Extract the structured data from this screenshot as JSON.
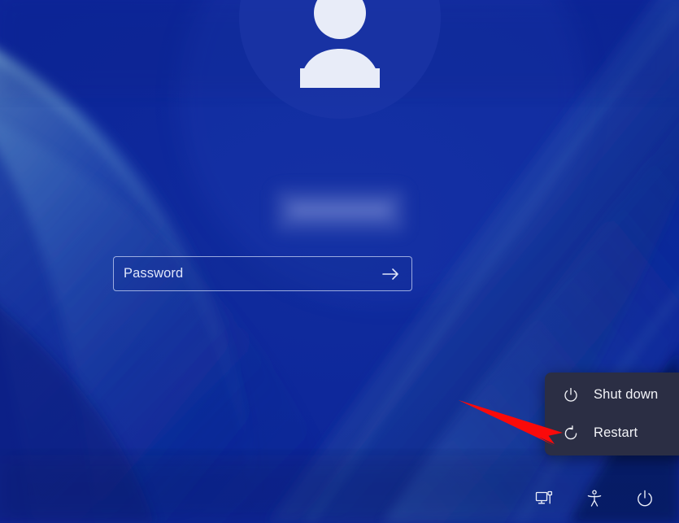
{
  "screen": {
    "kind": "windows-lock-screen",
    "background_name": "windows-bloom-wallpaper",
    "background_colors": {
      "deep": "#071659",
      "mid": "#0d2a9a",
      "bright": "#2f5ec0",
      "highlight": "#7fb4c9"
    }
  },
  "account": {
    "avatar_icon": "person-avatar-icon",
    "username": "",
    "username_state": "blurred-redacted"
  },
  "password": {
    "placeholder": "Password",
    "value": "",
    "submit_icon": "arrow-right-icon"
  },
  "power_menu": {
    "visible": true,
    "background_color": "#2b2e44",
    "items": [
      {
        "label": "Shut down",
        "icon": "power-icon"
      },
      {
        "label": "Restart",
        "icon": "restart-icon"
      }
    ]
  },
  "bottom_bar": {
    "items": [
      {
        "label": "Network",
        "icon": "network-monitor-icon"
      },
      {
        "label": "Ease of access",
        "icon": "accessibility-icon"
      },
      {
        "label": "Power",
        "icon": "power-icon"
      }
    ]
  },
  "annotation": {
    "type": "arrow",
    "color": "#fa0a0a",
    "points_to": "Restart"
  }
}
